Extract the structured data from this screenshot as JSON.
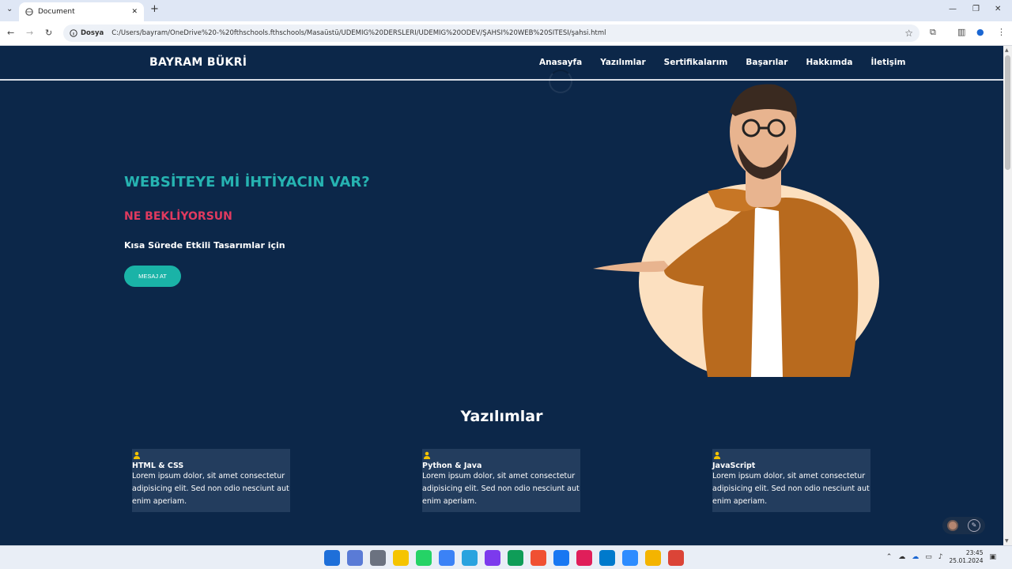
{
  "browser": {
    "tab_title": "Document",
    "address_chip": "Dosya",
    "url": "C:/Users/bayram/OneDrive%20-%20fthschools.fthschools/Masaüstü/UDEMİG%20DERSLERİ/UDEMİG%20ÖDEV/ŞAHSİ%20WEB%20SİTESİ/şahsi.html"
  },
  "site": {
    "logo": "BAYRAM BÜKRİ",
    "nav": [
      "Anasayfa",
      "Yazılımlar",
      "Sertifikalarım",
      "Başarılar",
      "Hakkımda",
      "İletişim"
    ],
    "hero": {
      "headline": "WEBSİTEYE Mİ İHTİYACIN VAR?",
      "subheadline": "NE BEKLİYORSUN",
      "tagline": "Kısa Sürede Etkili Tasarımlar için",
      "cta_label": "MESAJ AT"
    },
    "section_title": "Yazılımlar",
    "cards": [
      {
        "title": "HTML & CSS",
        "text": "Lorem ipsum dolor, sit amet consectetur adipisicing elit. Sed non odio nesciunt aut enim aperiam."
      },
      {
        "title": "Python & Java",
        "text": "Lorem ipsum dolor, sit amet consectetur adipisicing elit. Sed non odio nesciunt aut enim aperiam."
      },
      {
        "title": "JavaScript",
        "text": "Lorem ipsum dolor, sit amet consectetur adipisicing elit. Sed non odio nesciunt aut enim aperiam."
      }
    ]
  },
  "taskbar": {
    "time": "23:45",
    "date": "25.01.2024",
    "apps": [
      "windows-start-icon",
      "copilot-icon",
      "task-view-icon",
      "sticky-notes-icon",
      "whatsapp-icon",
      "paint-icon",
      "telegram-icon",
      "github-desktop-icon",
      "edge-icon",
      "git-icon",
      "messenger-icon",
      "slack-icon",
      "vscode-icon",
      "zoom-icon",
      "file-explorer-icon",
      "chrome-icon"
    ]
  },
  "colors": {
    "page_bg": "#0c2749",
    "accent_teal": "#26b3b1",
    "accent_pink": "#e03a5f",
    "card_bg": "#233d5e"
  }
}
